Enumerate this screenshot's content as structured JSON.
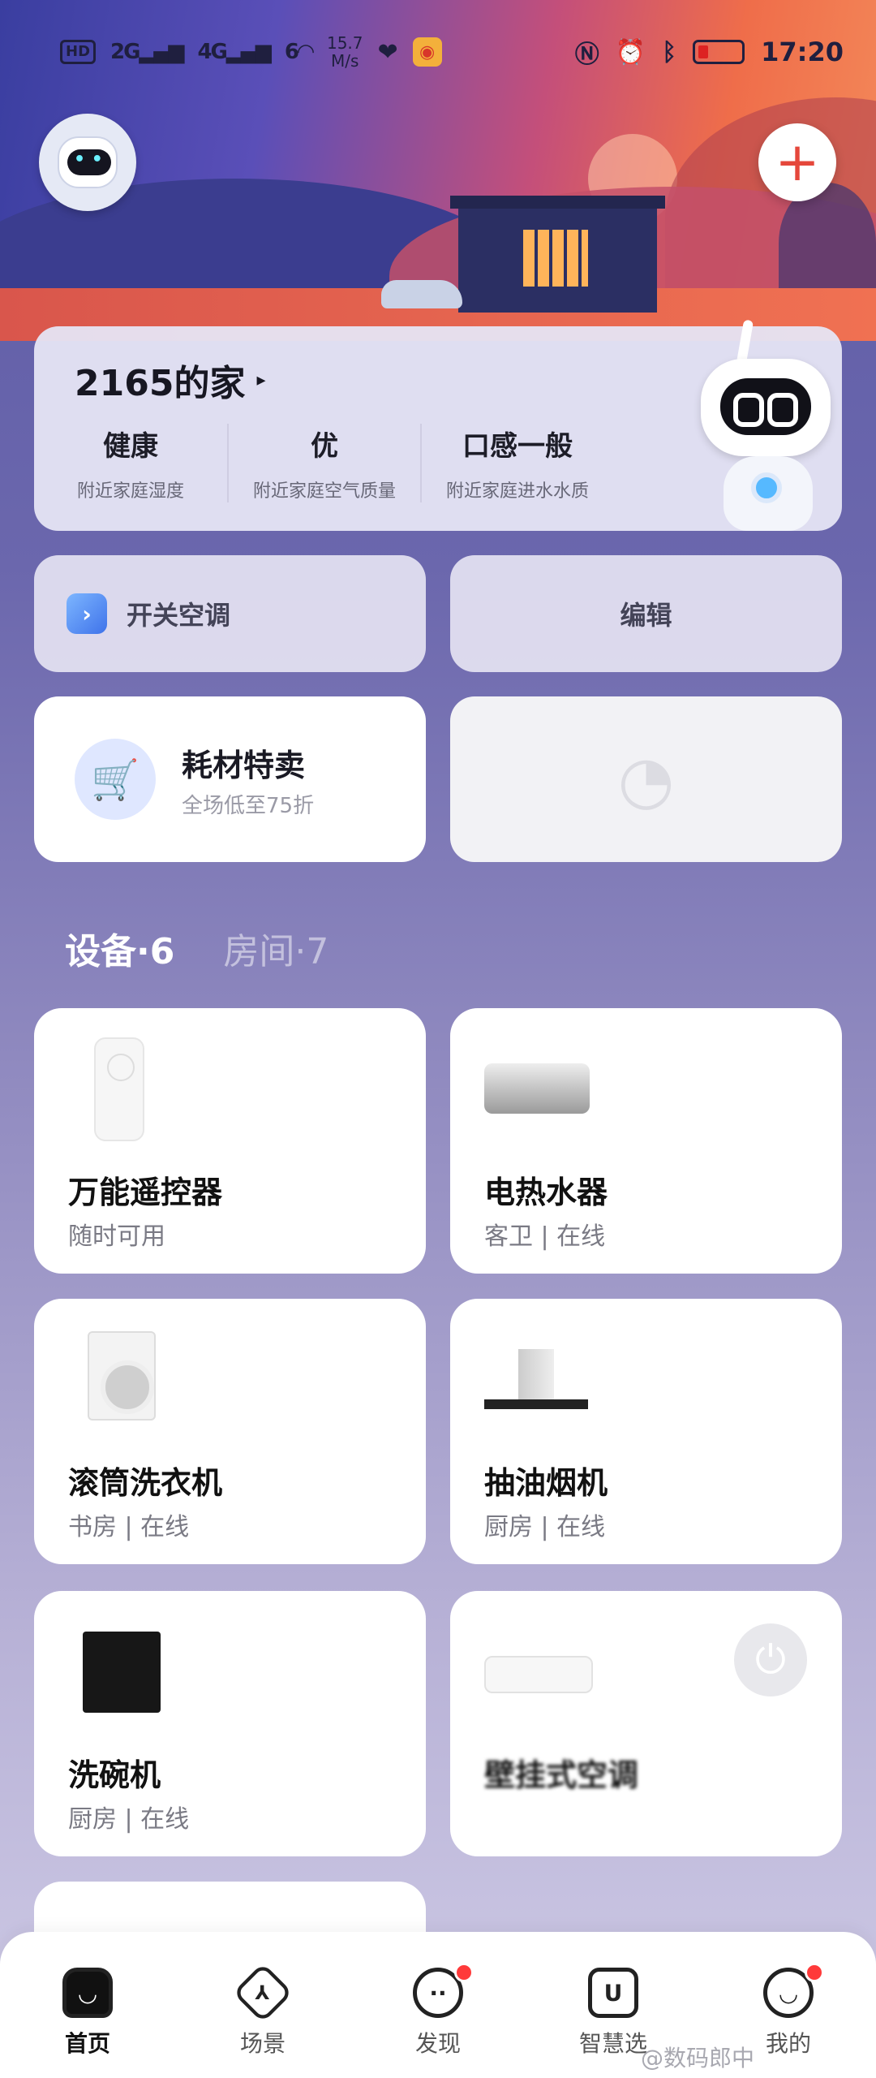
{
  "status_bar": {
    "hd_label": "HD",
    "net1": "2G",
    "net2": "4G",
    "net3": "6",
    "speed_value": "15.7",
    "speed_unit": "M/s",
    "time": "17:20"
  },
  "header": {
    "add_symbol": "+"
  },
  "home": {
    "title": "2165的家",
    "arrow": "▸",
    "stats": [
      {
        "value": "健康",
        "label": "附近家庭湿度"
      },
      {
        "value": "优",
        "label": "附近家庭空气质量"
      },
      {
        "value": "口感一般",
        "label": "附近家庭进水水质"
      }
    ]
  },
  "actions": {
    "ac_label": "开关空调",
    "edit_label": "编辑"
  },
  "promo": {
    "title": "耗材特卖",
    "subtitle": "全场低至75折"
  },
  "tabs": {
    "devices": "设备·6",
    "rooms": "房间·7"
  },
  "devices": [
    {
      "name": "万能遥控器",
      "meta": "随时可用"
    },
    {
      "name": "电热水器",
      "meta": "客卫 | 在线"
    },
    {
      "name": "滚筒洗衣机",
      "meta": "书房 | 在线"
    },
    {
      "name": "抽油烟机",
      "meta": "厨房 | 在线"
    },
    {
      "name": "洗碗机",
      "meta": "厨房 | 在线"
    },
    {
      "name": "壁挂式空调",
      "meta": ""
    }
  ],
  "nav": {
    "items": [
      {
        "label": "首页",
        "icon": "home-icon",
        "active": true
      },
      {
        "label": "场景",
        "icon": "scene-icon"
      },
      {
        "label": "发现",
        "icon": "discover-icon",
        "badge": true
      },
      {
        "label": "智慧选",
        "icon": "shop-icon"
      },
      {
        "label": "我的",
        "icon": "profile-icon",
        "badge": true
      }
    ]
  },
  "watermark": "@数码郎中"
}
